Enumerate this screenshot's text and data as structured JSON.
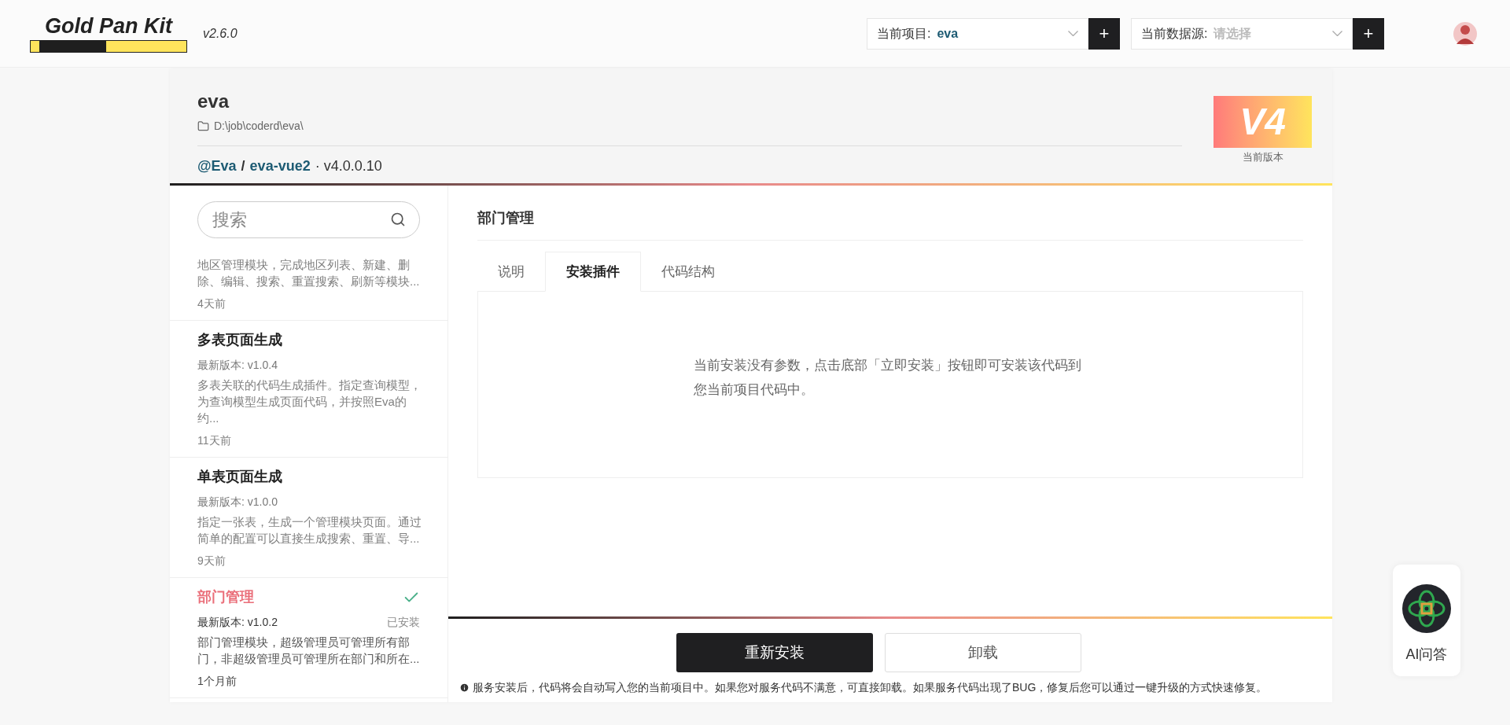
{
  "header": {
    "logo": "Gold Pan Kit",
    "version": "v2.6.0",
    "selects": [
      {
        "label": "当前项目:",
        "value": "eva"
      },
      {
        "label": "当前数据源:",
        "placeholder": "请选择"
      }
    ],
    "add_label": "+"
  },
  "project": {
    "name": "eva",
    "path": "D:\\job\\coderd\\eva\\",
    "owner": "@Eva",
    "separator": "/",
    "repo": "eva-vue2",
    "version": "· v4.0.0.10",
    "badge": "V4",
    "badge_caption": "当前版本"
  },
  "search": {
    "placeholder": "搜索"
  },
  "plugins": [
    {
      "description": "地区管理模块，完成地区列表、新建、删除、编辑、搜索、重置搜索、刷新等模块...",
      "time": "4天前",
      "selected": false,
      "installed": false
    },
    {
      "title": "多表页面生成",
      "version": "最新版本: v1.0.4",
      "description": "多表关联的代码生成插件。指定查询模型，为查询模型生成页面代码，并按照Eva的约...",
      "time": "11天前",
      "selected": false,
      "installed": false
    },
    {
      "title": "单表页面生成",
      "version": "最新版本: v1.0.0",
      "description": "指定一张表，生成一个管理模块页面。通过简单的配置可以直接生成搜索、重置、导...",
      "time": "9天前",
      "selected": false,
      "installed": false
    },
    {
      "title": "部门管理",
      "version": "最新版本: v1.0.2",
      "status": "已安装",
      "description": "部门管理模块，超级管理员可管理所有部门，非超级管理员可管理所在部门和所在...",
      "time": "1个月前",
      "selected": true,
      "installed": true
    }
  ],
  "detail": {
    "title": "部门管理",
    "tabs": [
      {
        "label": "说明",
        "selected": false
      },
      {
        "label": "安装插件",
        "selected": true
      },
      {
        "label": "代码结构",
        "selected": false
      }
    ],
    "message": "当前安装没有参数，点击底部「立即安装」按钮即可安装该代码到您当前项目代码中。",
    "buttons": [
      {
        "label": "重新安装",
        "kind": "primary"
      },
      {
        "label": "卸载",
        "kind": "secondary"
      }
    ],
    "note": "服务安装后，代码将会自动写入您的当前项目中。如果您对服务代码不满意，可直接卸载。如果服务代码出现了BUG，修复后您可以通过一键升级的方式快速修复。"
  },
  "assistant": {
    "label": "AI问答"
  }
}
